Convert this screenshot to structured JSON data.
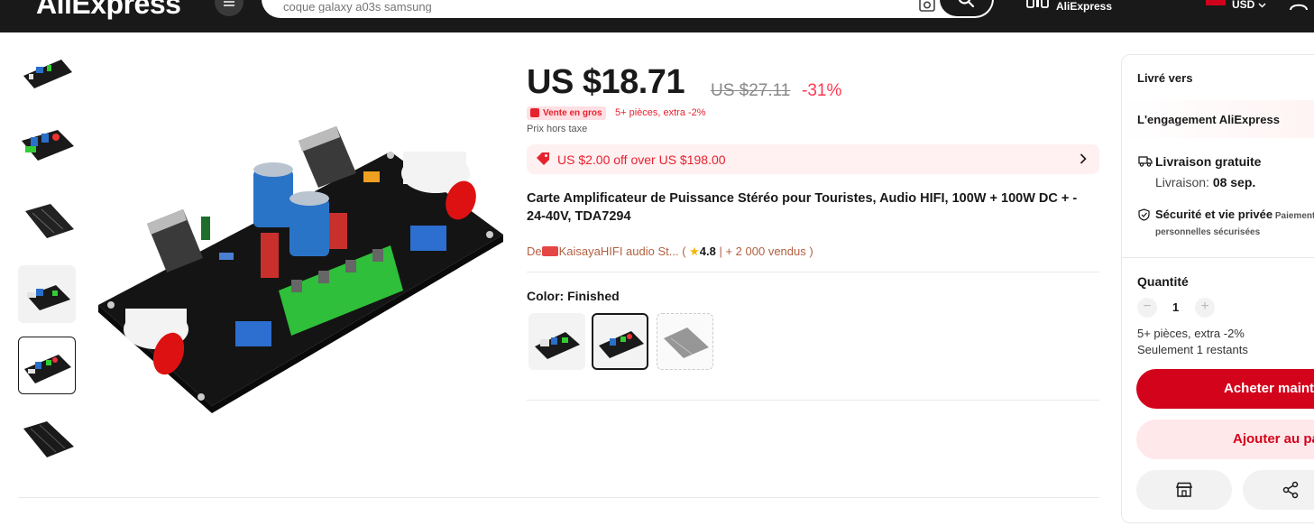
{
  "header": {
    "logo": "AliExpress",
    "search_placeholder": "coque galaxy a03s samsung",
    "app_label": "AliExpress",
    "currency": "USD",
    "icons": [
      "menu-icon",
      "camera-icon",
      "search-icon",
      "app-icon",
      "flag-icon",
      "chevron-down-icon",
      "user-icon"
    ]
  },
  "gallery": {
    "thumbnail_count": 6,
    "active_index": 4
  },
  "product": {
    "price_now": "US $18.71",
    "price_old": "US $27.11",
    "discount": "-31%",
    "bulk_badge": "Vente en gros",
    "bulk_text": "5+ pièces, extra -2%",
    "tax_text": "Prix hors taxe",
    "coupon_text": "US $2.00 off over US $198.00",
    "title": "Carte Amplificateur de Puissance Stéréo pour Touristes, Audio HIFI, 100W + 100W DC + - 24-40V, TDA7294",
    "store": {
      "prefix": "De",
      "name": "KaisayaHIFI audio St...",
      "open_paren": " ( ",
      "rating": "4.8",
      "sold": " | + 2 000 vendus )"
    },
    "color_label": "Color: Finished",
    "swatches": [
      {
        "name": "variant-1",
        "selected": false,
        "disabled": false
      },
      {
        "name": "variant-2",
        "selected": true,
        "disabled": false
      },
      {
        "name": "variant-3",
        "selected": false,
        "disabled": true
      }
    ]
  },
  "panel": {
    "ship_to": "Livré vers",
    "commitment": "L'engagement AliExpress",
    "free_shipping": "Livraison gratuite",
    "delivery_prefix": "Livraison: ",
    "delivery_date": "08 sep.",
    "security": "Sécurité et vie privée",
    "security_small": " Paiements",
    "security_sub": "personnelles sécurisées",
    "quantity_label": "Quantité",
    "quantity_minus": "−",
    "quantity_value": "1",
    "quantity_plus": "+",
    "quantity_note": "5+ pièces, extra -2%",
    "stock_note": "Seulement 1 restants",
    "buy_now": "Acheter maintenant",
    "add_to_cart": "Ajouter au panier"
  },
  "colors": {
    "header_bg": "#191919",
    "accent_red": "#d3031c",
    "price_red": "#fd384f",
    "coupon_bg": "#fff0f1"
  }
}
